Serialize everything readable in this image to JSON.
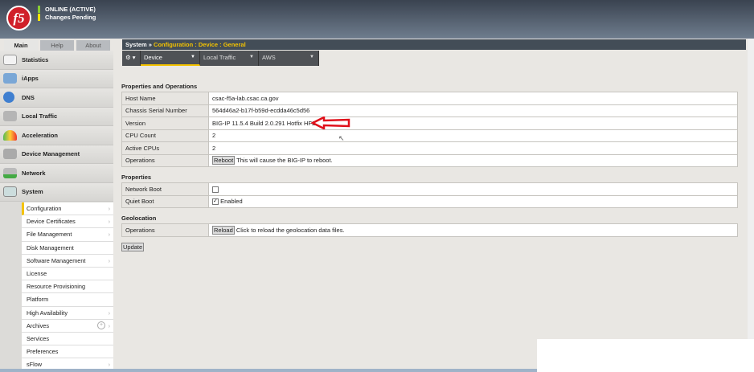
{
  "header": {
    "status_online": "ONLINE (ACTIVE)",
    "status_pending": "Changes Pending",
    "logo": "f5",
    "online_color": "#88cc33",
    "pending_color": "#f4e400"
  },
  "tabs": [
    "Main",
    "Help",
    "About"
  ],
  "nav": [
    {
      "label": "Statistics",
      "icon": "statistics-icon"
    },
    {
      "label": "iApps",
      "icon": "iapps-icon"
    },
    {
      "label": "DNS",
      "icon": "dns-globe-icon"
    },
    {
      "label": "Local Traffic",
      "icon": "local-traffic-icon"
    },
    {
      "label": "Acceleration",
      "icon": "gauge-icon"
    },
    {
      "label": "Device Management",
      "icon": "device-stack-icon"
    },
    {
      "label": "Network",
      "icon": "network-icon"
    },
    {
      "label": "System",
      "icon": "system-icon"
    }
  ],
  "submenu": [
    "Configuration",
    "Device Certificates",
    "File Management",
    "Disk Management",
    "Software Management",
    "License",
    "Resource Provisioning",
    "Platform",
    "High Availability",
    "Archives",
    "Services",
    "Preferences",
    "sFlow"
  ],
  "breadcrumb": {
    "root": "System",
    "sep": "»",
    "path": "Configuration : Device : General"
  },
  "menu_tabs": [
    "Device",
    "Local Traffic",
    "AWS"
  ],
  "sections": {
    "props_ops": {
      "title": "Properties and Operations",
      "rows": [
        {
          "label": "Host Name",
          "value": "csac-f5a-lab.csac.ca.gov"
        },
        {
          "label": "Chassis Serial Number",
          "value": "564d46a2-b17f-b59d-ecdda46c5d56"
        },
        {
          "label": "Version",
          "value": "BIG-IP 11.5.4 Build 2.0.291 Hotfix HF2"
        },
        {
          "label": "CPU Count",
          "value": "2"
        },
        {
          "label": "Active CPUs",
          "value": "2"
        }
      ],
      "ops_label": "Operations",
      "reboot_btn": "Reboot",
      "reboot_text": "This will cause the BIG-IP to reboot."
    },
    "properties": {
      "title": "Properties",
      "network_boot": "Network Boot",
      "quiet_boot": "Quiet Boot",
      "enabled": "Enabled"
    },
    "geo": {
      "title": "Geolocation",
      "ops_label": "Operations",
      "reload_btn": "Reload",
      "reload_text": "Click to reload the geolocation data files."
    }
  },
  "update_btn": "Update"
}
